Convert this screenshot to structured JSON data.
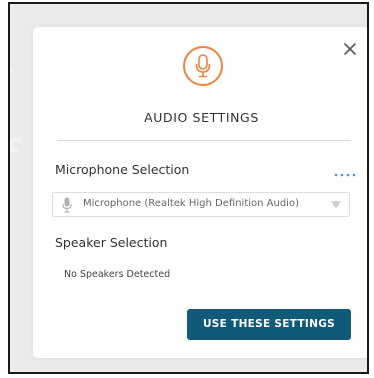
{
  "dialog": {
    "title": "AUDIO SETTINGS",
    "microphone": {
      "label": "Microphone Selection",
      "selected": "Microphone (Realtek High Definition Audio)"
    },
    "speaker": {
      "label": "Speaker Selection",
      "status": "No Speakers Detected"
    },
    "confirm_label": "USE THESE SETTINGS"
  },
  "icons": {
    "header": "microphone-icon",
    "close": "close-icon",
    "more": "more-options-icon",
    "select_mic": "microphone-icon",
    "dropdown": "chevron-down-icon"
  },
  "colors": {
    "accent_orange": "#f0813e",
    "primary_button": "#0f5a79",
    "more_dots": "#4a90d9",
    "backdrop": "#ebebeb"
  }
}
